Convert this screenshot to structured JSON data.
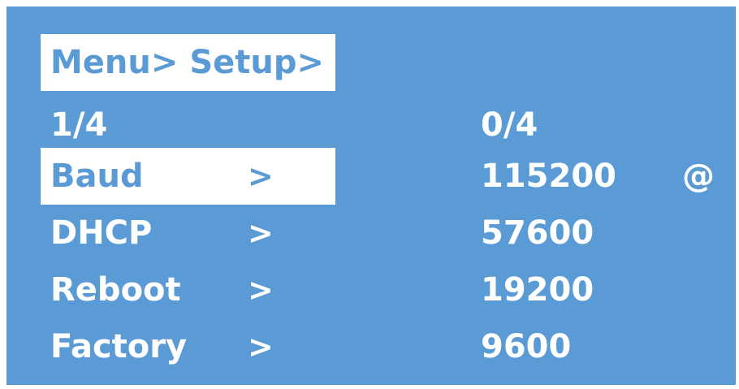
{
  "header": {
    "title": "Menu> Setup>"
  },
  "page_indicator": {
    "left": "1/4",
    "right": "0/4"
  },
  "menu": {
    "items": [
      {
        "label": "Baud",
        "arrow": ">",
        "selected": true
      },
      {
        "label": "DHCP",
        "arrow": ">"
      },
      {
        "label": "Reboot",
        "arrow": ">"
      },
      {
        "label": "Factory",
        "arrow": ">"
      }
    ]
  },
  "baud_options": {
    "values": [
      "115200",
      "57600",
      "19200",
      "9600"
    ],
    "current_marker": "@"
  },
  "colors": {
    "background": "#5b9bd5",
    "highlight": "#ffffff",
    "text": "#ffffff"
  }
}
